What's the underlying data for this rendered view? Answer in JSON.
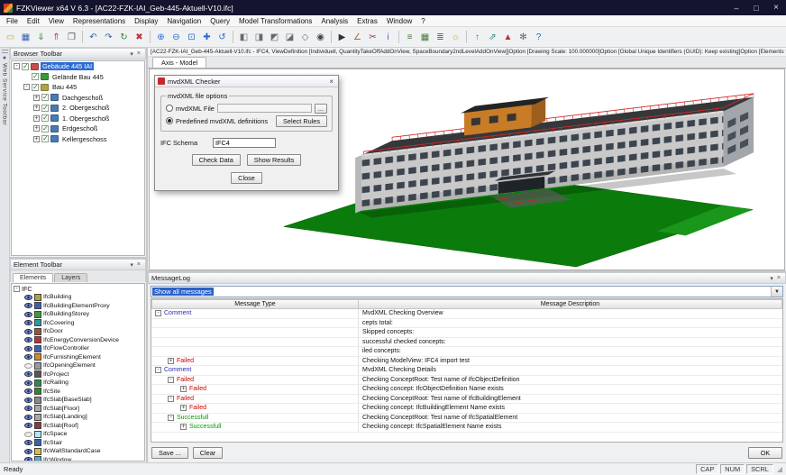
{
  "window": {
    "title": "FZKViewer x64 V 6.3 - [AC22-FZK-IAI_Geb-445-Aktuell-V10.ifc]"
  },
  "icons": {
    "minimize": "–",
    "maximize": "□",
    "close": "×",
    "dropdown": "▾",
    "combo_arrow": "▼",
    "grip": "◢",
    "web_service": "●"
  },
  "menu": {
    "items": [
      "File",
      "Edit",
      "View",
      "Representations",
      "Display",
      "Navigation",
      "Query",
      "Model Transformations",
      "Analysis",
      "Extras",
      "Window",
      "?"
    ]
  },
  "toolbar": {
    "icons": [
      {
        "type": "btn",
        "name": "open-folder-icon",
        "glyph": "▭",
        "color": "#d9a43b"
      },
      {
        "type": "btn",
        "name": "save-icon",
        "glyph": "▦",
        "color": "#3a62b0"
      },
      {
        "type": "btn",
        "name": "import-icon",
        "glyph": "⇓",
        "color": "#2f8a2f"
      },
      {
        "type": "btn",
        "name": "export-icon",
        "glyph": "⇑",
        "color": "#b03a3a"
      },
      {
        "type": "btn",
        "name": "print-icon",
        "glyph": "❐",
        "color": "#5a5a5a"
      },
      {
        "type": "sep",
        "name": "toolbar-separator"
      },
      {
        "type": "btn",
        "name": "undo-icon",
        "glyph": "↶",
        "color": "#3a62b0"
      },
      {
        "type": "btn",
        "name": "redo-icon",
        "glyph": "↷",
        "color": "#3a62b0"
      },
      {
        "type": "btn",
        "name": "refresh-icon",
        "glyph": "↻",
        "color": "#2f8a2f"
      },
      {
        "type": "btn",
        "name": "delete-icon",
        "glyph": "✖",
        "color": "#c03030"
      },
      {
        "type": "sep",
        "name": "toolbar-separator"
      },
      {
        "type": "btn",
        "name": "zoom-in-icon",
        "glyph": "⊕",
        "color": "#2a6ad0"
      },
      {
        "type": "btn",
        "name": "zoom-out-icon",
        "glyph": "⊖",
        "color": "#2a6ad0"
      },
      {
        "type": "btn",
        "name": "zoom-fit-icon",
        "glyph": "⊡",
        "color": "#2a6ad0"
      },
      {
        "type": "btn",
        "name": "pan-icon",
        "glyph": "✚",
        "color": "#2a6ad0"
      },
      {
        "type": "btn",
        "name": "rotate-view-icon",
        "glyph": "↺",
        "color": "#2a6ad0"
      },
      {
        "type": "sep",
        "name": "toolbar-separator"
      },
      {
        "type": "btn",
        "name": "view-top-icon",
        "glyph": "◧",
        "color": "#6a6a6a"
      },
      {
        "type": "btn",
        "name": "view-front-icon",
        "glyph": "◨",
        "color": "#6a6a6a"
      },
      {
        "type": "btn",
        "name": "view-left-icon",
        "glyph": "◩",
        "color": "#6a6a6a"
      },
      {
        "type": "btn",
        "name": "view-right-icon",
        "glyph": "◪",
        "color": "#6a6a6a"
      },
      {
        "type": "btn",
        "name": "view-iso-icon",
        "glyph": "◇",
        "color": "#6a6a6a"
      },
      {
        "type": "btn",
        "name": "camera-icon",
        "glyph": "◉",
        "color": "#444444"
      },
      {
        "type": "sep",
        "name": "toolbar-separator"
      },
      {
        "type": "btn",
        "name": "select-icon",
        "glyph": "▶",
        "color": "#333333"
      },
      {
        "type": "btn",
        "name": "measure-icon",
        "glyph": "∠",
        "color": "#b06a2a"
      },
      {
        "type": "btn",
        "name": "section-icon",
        "glyph": "✂",
        "color": "#b02a6a"
      },
      {
        "type": "btn",
        "name": "info-icon",
        "glyph": "i",
        "color": "#2a6ad0"
      },
      {
        "type": "sep",
        "name": "toolbar-separator"
      },
      {
        "type": "btn",
        "name": "tree-view-icon",
        "glyph": "≡",
        "color": "#4a7a3a"
      },
      {
        "type": "btn",
        "name": "grid-icon",
        "glyph": "▦",
        "color": "#4a7a3a"
      },
      {
        "type": "btn",
        "name": "layers-icon",
        "glyph": "≣",
        "color": "#8a4aa0"
      },
      {
        "type": "btn",
        "name": "light-icon",
        "glyph": "☼",
        "color": "#d0a02a"
      },
      {
        "type": "sep",
        "name": "toolbar-separator"
      },
      {
        "type": "btn",
        "name": "walk-icon",
        "glyph": "↑",
        "color": "#2a8a8a"
      },
      {
        "type": "btn",
        "name": "fly-icon",
        "glyph": "⇗",
        "color": "#2a8a8a"
      },
      {
        "type": "btn",
        "name": "north-icon",
        "glyph": "▲",
        "color": "#c03030"
      },
      {
        "type": "btn",
        "name": "settings-icon",
        "glyph": "✻",
        "color": "#666666"
      },
      {
        "type": "btn",
        "name": "help-icon",
        "glyph": "?",
        "color": "#2a6ad0"
      }
    ]
  },
  "web_service_toolbar": {
    "title": "Web Service Toolbar"
  },
  "browser_panel": {
    "title": "Browser Toolbar",
    "tree": [
      {
        "label": "Gebäude 445 IAI",
        "level": 0,
        "expander": "-",
        "selected": true,
        "icon_color": "#c05050"
      },
      {
        "label": "Gelände Bau 445",
        "level": 1,
        "expander": "",
        "selected": false,
        "icon_color": "#3a9a3a"
      },
      {
        "label": "Bau 445",
        "level": 1,
        "expander": "-",
        "selected": false,
        "icon_color": "#b0a24a"
      },
      {
        "label": "Dachgeschoß",
        "level": 2,
        "expander": "+",
        "selected": false,
        "icon_color": "#4a7ab0"
      },
      {
        "label": "2. Obergeschoß",
        "level": 2,
        "expander": "+",
        "selected": false,
        "icon_color": "#4a7ab0"
      },
      {
        "label": "1. Obergeschoß",
        "level": 2,
        "expander": "+",
        "selected": false,
        "icon_color": "#4a7ab0"
      },
      {
        "label": "Erdgeschoß",
        "level": 2,
        "expander": "+",
        "selected": false,
        "icon_color": "#4a7ab0"
      },
      {
        "label": "Kellergeschoss",
        "level": 2,
        "expander": "+",
        "selected": false,
        "icon_color": "#4a7ab0"
      }
    ]
  },
  "element_panel": {
    "title": "Element Toolbar",
    "tabs": [
      {
        "label": "Elements",
        "active": true
      },
      {
        "label": "Layers",
        "active": false
      }
    ],
    "root": "IFC",
    "items": [
      {
        "label": "IfcBuilding",
        "color": "#b0a23a",
        "eye": "visible"
      },
      {
        "label": "IfcBuildingElementProxy",
        "color": "#3a62b0",
        "eye": "visible"
      },
      {
        "label": "IfcBuildingStorey",
        "color": "#3a9a3a",
        "eye": "visible"
      },
      {
        "label": "IfcCovering",
        "color": "#2a9a9a",
        "eye": "visible"
      },
      {
        "label": "IfcDoor",
        "color": "#a0522d",
        "eye": "visible"
      },
      {
        "label": "IfcEnergyConversionDevice",
        "color": "#c03030",
        "eye": "visible"
      },
      {
        "label": "IfcFlowController",
        "color": "#3a62b0",
        "eye": "visible"
      },
      {
        "label": "IfcFurnishingElement",
        "color": "#d08a2a",
        "eye": "visible"
      },
      {
        "label": "IfcOpeningElement",
        "color": "#9a9a9a",
        "eye": "hidden"
      },
      {
        "label": "IfcProject",
        "color": "#555555",
        "eye": "visible"
      },
      {
        "label": "IfcRailing",
        "color": "#2a8a4a",
        "eye": "visible"
      },
      {
        "label": "IfcSite",
        "color": "#2a8a2a",
        "eye": "visible"
      },
      {
        "label": "IfcSlab[BaseSlab]",
        "color": "#8a8a8a",
        "eye": "visible"
      },
      {
        "label": "IfcSlab[Floor]",
        "color": "#a8a8a8",
        "eye": "visible"
      },
      {
        "label": "IfcSlab[Landing]",
        "color": "#a8a8a8",
        "eye": "visible"
      },
      {
        "label": "IfcSlab[Roof]",
        "color": "#8a3a3a",
        "eye": "visible"
      },
      {
        "label": "IfcSpace",
        "color": "#aee7f8",
        "eye": "hidden"
      },
      {
        "label": "IfcStair",
        "color": "#3a62b0",
        "eye": "visible"
      },
      {
        "label": "IfcWallStandardCase",
        "color": "#d0c23a",
        "eye": "visible"
      },
      {
        "label": "IfcWindow",
        "color": "#4ab0d0",
        "eye": "visible"
      }
    ]
  },
  "document": {
    "info_bar": "[AC22-FZK-IAI_Geb-445-Aktuell-V10.ifc  -  IFC4, ViewDefinition [Individuell, QuantityTakeOffAddOnView, SpaceBoundary2ndLevelAddOnView]]Option [Drawing Scale: 100.000000]Option [Global Unique Identifiers (GUID): Keep existing]Option [Elements to export: Entire project]Option [Partial S",
    "tab": "Axis - Model"
  },
  "dialog": {
    "title": "mvdXML Checker",
    "group_label": "mvdXML file options",
    "radio1": "mvdXML File",
    "radio2": "Predefined mvdXML definitions",
    "browse_button": "...",
    "select_rules_button": "Select Rules",
    "ifc_schema_label": "IFC Schema",
    "ifc_schema_value": "IFC4",
    "check_data_button": "Check Data",
    "show_results_button": "Show Results",
    "close_button": "Close"
  },
  "message_log": {
    "title": "MessageLog",
    "filter": "Show all messages",
    "columns": [
      "Message Type",
      "Message Description"
    ],
    "rows": [
      {
        "expander": "-",
        "type": "Comment",
        "status": "comment",
        "indent": 0,
        "desc": "MvdXML Checking Overview"
      },
      {
        "expander": "",
        "type": "",
        "status": "",
        "indent": 1,
        "desc": "cepts total:"
      },
      {
        "expander": "",
        "type": "",
        "status": "",
        "indent": 1,
        "desc": "Skipped concepts:"
      },
      {
        "expander": "",
        "type": "",
        "status": "",
        "indent": 1,
        "desc": "successful checked concepts:"
      },
      {
        "expander": "",
        "type": "",
        "status": "",
        "indent": 1,
        "desc": "iled concepts:"
      },
      {
        "expander": "+",
        "type": "Failed",
        "status": "failed",
        "indent": 1,
        "desc": "Checking ModelView: IFC4 import test"
      },
      {
        "expander": "-",
        "type": "Comment",
        "status": "comment",
        "indent": 0,
        "desc": "MvdXML Checking Details"
      },
      {
        "expander": "-",
        "type": "Failed",
        "status": "failed",
        "indent": 1,
        "desc": "Checking ConceptRoot: Test name of IfcObjectDefinition"
      },
      {
        "expander": "+",
        "type": "Failed",
        "status": "failed",
        "indent": 2,
        "desc": "Checking concept: IfcObjectDefinition Name exists"
      },
      {
        "expander": "-",
        "type": "Failed",
        "status": "failed",
        "indent": 1,
        "desc": "Checking ConceptRoot: Test name of IfcBuildingElement"
      },
      {
        "expander": "+",
        "type": "Failed",
        "status": "failed",
        "indent": 2,
        "desc": "Checking concept: IfcBuildingElement Name exists"
      },
      {
        "expander": "-",
        "type": "Successfull",
        "status": "success",
        "indent": 1,
        "desc": "Checking ConceptRoot: Test name of IfcSpatialElement"
      },
      {
        "expander": "+",
        "type": "Successfull",
        "status": "success",
        "indent": 2,
        "desc": "Checking concept: IfcSpatialElement Name exists"
      }
    ],
    "save_button": "Save ...",
    "clear_button": "Clear",
    "ok_button": "OK"
  },
  "status_bar": {
    "ready": "Ready",
    "toggles": [
      "CAP",
      "NUM",
      "SCRL"
    ]
  }
}
